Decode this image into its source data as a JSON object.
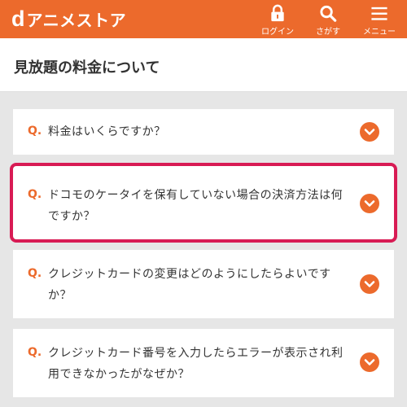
{
  "header": {
    "logo_mark": "d",
    "logo_text": "アニメストア",
    "login_label": "ログイン",
    "search_label": "さがす",
    "menu_label": "メニュー",
    "accent_color": "#ec6a2c"
  },
  "page": {
    "title": "見放題の料金について"
  },
  "faq": {
    "q_marker": "Q.",
    "items": [
      {
        "question": "料金はいくらですか？"
      },
      {
        "question": "ドコモのケータイを保有していない場合の決済方法は何ですか？"
      },
      {
        "question": "クレジットカードの変更はどのようにしたらよいですか？"
      },
      {
        "question": "クレジットカード番号を入力したらエラーが表示され利用できなかったがなぜか？"
      }
    ],
    "highlight_color": "#d81b54"
  }
}
